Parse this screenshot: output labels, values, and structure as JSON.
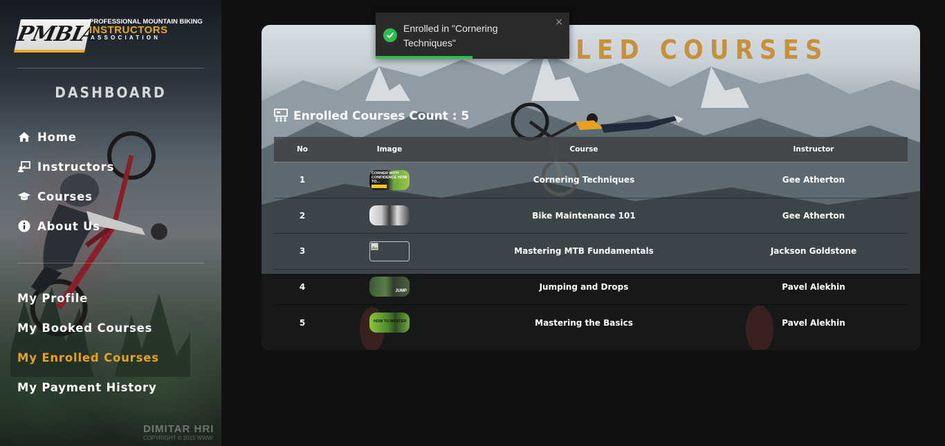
{
  "sidebar": {
    "logo": {
      "mark": "PMBIA",
      "line1": "PROFESSIONAL MOUNTAIN BIKING",
      "line2": "INSTRUCTORS",
      "line3": "ASSOCIATION"
    },
    "heading": "DASHBOARD",
    "nav": [
      {
        "label": "Home",
        "icon": "home-icon"
      },
      {
        "label": "Instructors",
        "icon": "instructor-board-icon"
      },
      {
        "label": "Courses",
        "icon": "graduation-cap-icon"
      },
      {
        "label": "About Us",
        "icon": "info-icon"
      }
    ],
    "account_nav": [
      {
        "label": "My Profile",
        "active": false
      },
      {
        "label": "My Booked Courses",
        "active": false
      },
      {
        "label": "My Enrolled Courses",
        "active": true
      },
      {
        "label": "My Payment History",
        "active": false
      }
    ],
    "watermark": "DIMITAR HRI",
    "watermark_small": "COPYRIGHT © 2015 WWW"
  },
  "main": {
    "title": "MY ENROLLED COURSES",
    "count_label": "Enrolled Courses Count : 5",
    "count_icon": "classroom-icon",
    "table": {
      "headers": {
        "no": "No",
        "image": "Image",
        "course": "Course",
        "instructor": "Instructor"
      },
      "rows": [
        {
          "no": "1",
          "course": "Cornering Techniques",
          "instructor": "Gee Atherton",
          "thumb_text": "CORNER WITH CONFIDENCE HOW TO..."
        },
        {
          "no": "2",
          "course": "Bike Maintenance 101",
          "instructor": "Gee Atherton",
          "thumb_text": ""
        },
        {
          "no": "3",
          "course": "Mastering MTB Fundamentals",
          "instructor": "Jackson Goldstone",
          "thumb_text": ""
        },
        {
          "no": "4",
          "course": "Jumping and Drops",
          "instructor": "Pavel Alekhin",
          "thumb_text": "JUMP"
        },
        {
          "no": "5",
          "course": "Mastering the Basics",
          "instructor": "Pavel Alekhin",
          "thumb_text": "HOW TO MASTER"
        }
      ]
    }
  },
  "toast": {
    "message": "Enrolled in \"Cornering Techniques\"",
    "close": "×",
    "progress": 0.5,
    "color": "#2ebd4f"
  },
  "colors": {
    "accent": "#e8a020",
    "title": "#c78a2a",
    "success": "#2ebd4f"
  }
}
